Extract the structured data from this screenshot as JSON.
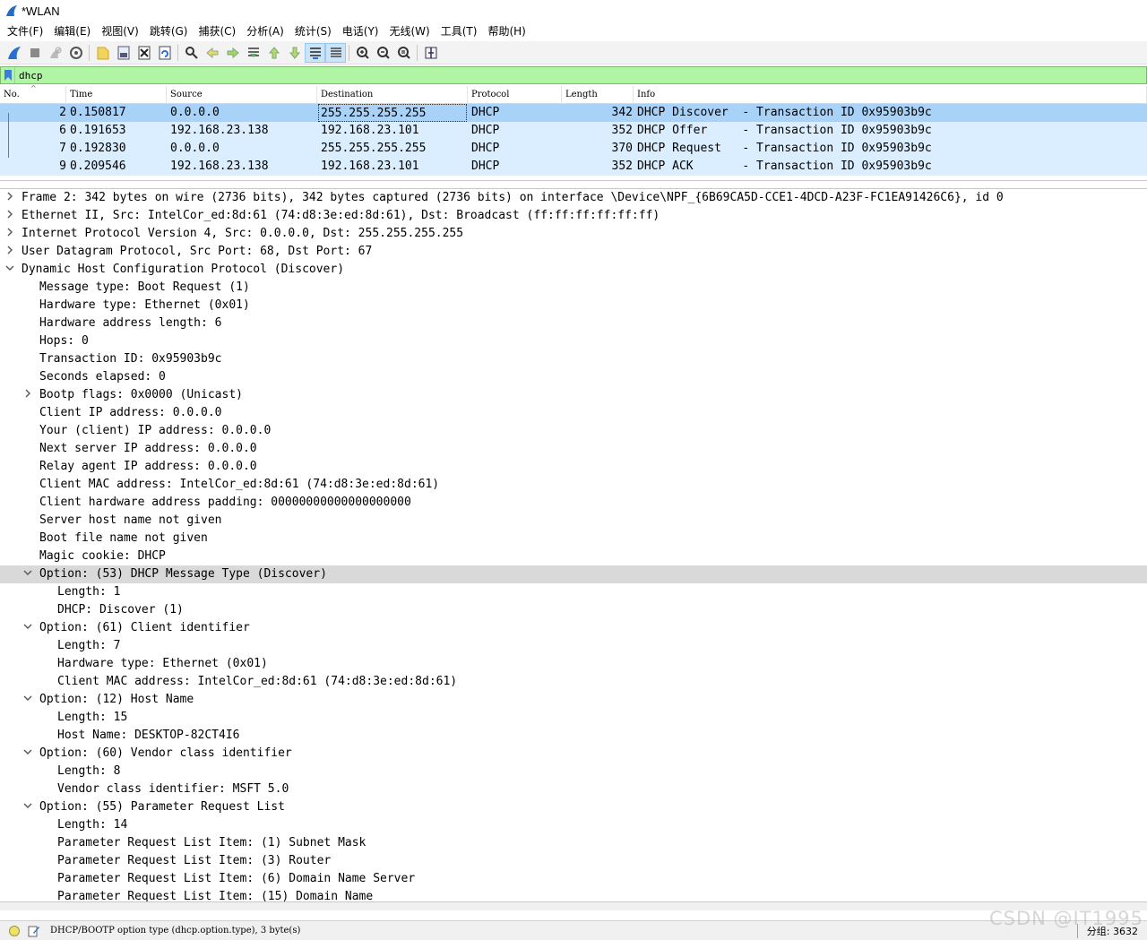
{
  "window": {
    "title": "*WLAN"
  },
  "menu": [
    "文件(F)",
    "编辑(E)",
    "视图(V)",
    "跳转(G)",
    "捕获(C)",
    "分析(A)",
    "统计(S)",
    "电话(Y)",
    "无线(W)",
    "工具(T)",
    "帮助(H)"
  ],
  "toolbar": [
    "start-capture",
    "stop-capture",
    "restart-capture",
    "capture-options",
    "open-file",
    "save-file",
    "close-file",
    "reload-file",
    "find-packet",
    "go-back",
    "go-forward",
    "go-to-packet",
    "go-first",
    "go-last",
    "auto-scroll",
    "colorize",
    "zoom-in",
    "zoom-out",
    "zoom-normal",
    "resize-columns"
  ],
  "filter": {
    "value": "dhcp"
  },
  "packet_list": {
    "columns": [
      "No.",
      "Time",
      "Source",
      "Destination",
      "Protocol",
      "Length",
      "Info"
    ],
    "rows": [
      {
        "no": "2",
        "time": "0.150817",
        "source": "0.0.0.0",
        "destination": "255.255.255.255",
        "protocol": "DHCP",
        "length": "342",
        "info": "DHCP Discover  - Transaction ID 0x95903b9c"
      },
      {
        "no": "6",
        "time": "0.191653",
        "source": "192.168.23.138",
        "destination": "192.168.23.101",
        "protocol": "DHCP",
        "length": "352",
        "info": "DHCP Offer     - Transaction ID 0x95903b9c"
      },
      {
        "no": "7",
        "time": "0.192830",
        "source": "0.0.0.0",
        "destination": "255.255.255.255",
        "protocol": "DHCP",
        "length": "370",
        "info": "DHCP Request   - Transaction ID 0x95903b9c"
      },
      {
        "no": "9",
        "time": "0.209546",
        "source": "192.168.23.138",
        "destination": "192.168.23.101",
        "protocol": "DHCP",
        "length": "352",
        "info": "DHCP ACK       - Transaction ID 0x95903b9c"
      }
    ]
  },
  "details": [
    {
      "level": 0,
      "caret": ">",
      "text": "Frame 2: 342 bytes on wire (2736 bits), 342 bytes captured (2736 bits) on interface \\Device\\NPF_{6B69CA5D-CCE1-4DCD-A23F-FC1EA91426C6}, id 0"
    },
    {
      "level": 0,
      "caret": ">",
      "text": "Ethernet II, Src: IntelCor_ed:8d:61 (74:d8:3e:ed:8d:61), Dst: Broadcast (ff:ff:ff:ff:ff:ff)"
    },
    {
      "level": 0,
      "caret": ">",
      "text": "Internet Protocol Version 4, Src: 0.0.0.0, Dst: 255.255.255.255"
    },
    {
      "level": 0,
      "caret": ">",
      "text": "User Datagram Protocol, Src Port: 68, Dst Port: 67"
    },
    {
      "level": 0,
      "caret": "v",
      "text": "Dynamic Host Configuration Protocol (Discover)"
    },
    {
      "level": 1,
      "caret": "",
      "text": "Message type: Boot Request (1)"
    },
    {
      "level": 1,
      "caret": "",
      "text": "Hardware type: Ethernet (0x01)"
    },
    {
      "level": 1,
      "caret": "",
      "text": "Hardware address length: 6"
    },
    {
      "level": 1,
      "caret": "",
      "text": "Hops: 0"
    },
    {
      "level": 1,
      "caret": "",
      "text": "Transaction ID: 0x95903b9c"
    },
    {
      "level": 1,
      "caret": "",
      "text": "Seconds elapsed: 0"
    },
    {
      "level": 1,
      "caret": ">",
      "text": "Bootp flags: 0x0000 (Unicast)"
    },
    {
      "level": 1,
      "caret": "",
      "text": "Client IP address: 0.0.0.0"
    },
    {
      "level": 1,
      "caret": "",
      "text": "Your (client) IP address: 0.0.0.0"
    },
    {
      "level": 1,
      "caret": "",
      "text": "Next server IP address: 0.0.0.0"
    },
    {
      "level": 1,
      "caret": "",
      "text": "Relay agent IP address: 0.0.0.0"
    },
    {
      "level": 1,
      "caret": "",
      "text": "Client MAC address: IntelCor_ed:8d:61 (74:d8:3e:ed:8d:61)"
    },
    {
      "level": 1,
      "caret": "",
      "text": "Client hardware address padding: 00000000000000000000"
    },
    {
      "level": 1,
      "caret": "",
      "text": "Server host name not given"
    },
    {
      "level": 1,
      "caret": "",
      "text": "Boot file name not given"
    },
    {
      "level": 1,
      "caret": "",
      "text": "Magic cookie: DHCP"
    },
    {
      "level": 1,
      "caret": "v",
      "text": "Option: (53) DHCP Message Type (Discover)",
      "highlight": true
    },
    {
      "level": 2,
      "caret": "",
      "text": "Length: 1"
    },
    {
      "level": 2,
      "caret": "",
      "text": "DHCP: Discover (1)"
    },
    {
      "level": 1,
      "caret": "v",
      "text": "Option: (61) Client identifier"
    },
    {
      "level": 2,
      "caret": "",
      "text": "Length: 7"
    },
    {
      "level": 2,
      "caret": "",
      "text": "Hardware type: Ethernet (0x01)"
    },
    {
      "level": 2,
      "caret": "",
      "text": "Client MAC address: IntelCor_ed:8d:61 (74:d8:3e:ed:8d:61)"
    },
    {
      "level": 1,
      "caret": "v",
      "text": "Option: (12) Host Name"
    },
    {
      "level": 2,
      "caret": "",
      "text": "Length: 15"
    },
    {
      "level": 2,
      "caret": "",
      "text": "Host Name: DESKTOP-82CT4I6"
    },
    {
      "level": 1,
      "caret": "v",
      "text": "Option: (60) Vendor class identifier"
    },
    {
      "level": 2,
      "caret": "",
      "text": "Length: 8"
    },
    {
      "level": 2,
      "caret": "",
      "text": "Vendor class identifier: MSFT 5.0"
    },
    {
      "level": 1,
      "caret": "v",
      "text": "Option: (55) Parameter Request List"
    },
    {
      "level": 2,
      "caret": "",
      "text": "Length: 14"
    },
    {
      "level": 2,
      "caret": "",
      "text": "Parameter Request List Item: (1) Subnet Mask"
    },
    {
      "level": 2,
      "caret": "",
      "text": "Parameter Request List Item: (3) Router"
    },
    {
      "level": 2,
      "caret": "",
      "text": "Parameter Request List Item: (6) Domain Name Server"
    },
    {
      "level": 2,
      "caret": "",
      "text": "Parameter Request List Item: (15) Domain Name"
    }
  ],
  "status": {
    "field_info": "DHCP/BOOTP option type (dhcp.option.type), 3 byte(s)",
    "packets": "分组: 3632"
  },
  "watermark": "CSDN @IT1995"
}
